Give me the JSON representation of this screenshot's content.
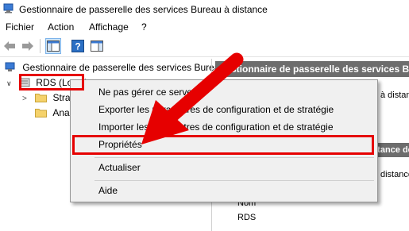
{
  "window": {
    "title": "Gestionnaire de passerelle des services Bureau à distance"
  },
  "menubar": {
    "items": [
      "Fichier",
      "Action",
      "Affichage",
      "?"
    ]
  },
  "toolbar": {
    "icons": [
      "back-arrow-icon",
      "forward-arrow-icon",
      "show-hide-tree-icon",
      "help-icon",
      "properties-panel-icon"
    ]
  },
  "tree": {
    "root_label": "Gestionnaire de passerelle des services Bureau à distance",
    "server_label": "RDS (Local)",
    "children": [
      "Stratégies",
      "Analyse"
    ]
  },
  "right_pane": {
    "header": "Gestionnaire de passerelle des services Bureau à distance",
    "line1": "à distance",
    "band": "istance de",
    "line2": "distance s",
    "column_name": "Nom",
    "value_name": "RDS"
  },
  "context_menu": {
    "items": [
      "Ne pas gérer ce serveur",
      "Exporter les paramètres de configuration et de stratégie",
      "Importer les paramètres de configuration et de stratégie",
      "Propriétés",
      "Actualiser",
      "Aide"
    ]
  },
  "colors": {
    "highlight": "#e60000",
    "header_gray": "#6d6d6d",
    "menu_bg": "#f0f0f0"
  }
}
